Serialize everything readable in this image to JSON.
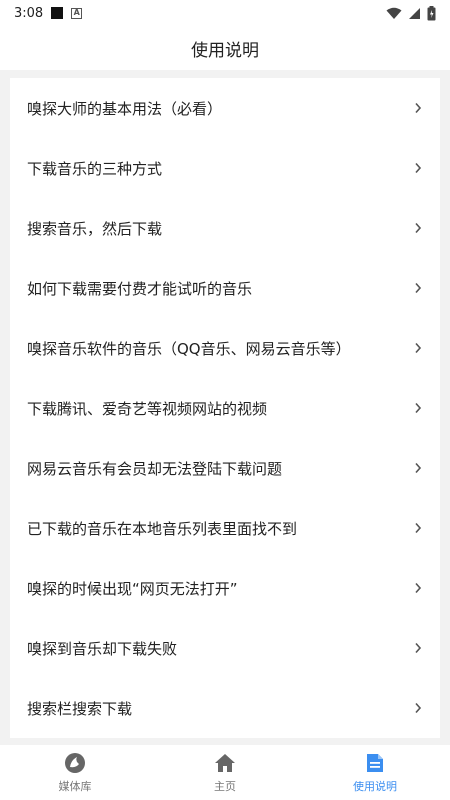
{
  "status_bar": {
    "time": "3:08"
  },
  "header": {
    "title": "使用说明"
  },
  "items": [
    {
      "label": "嗅探大师的基本用法（必看）"
    },
    {
      "label": "下载音乐的三种方式"
    },
    {
      "label": "搜索音乐，然后下载"
    },
    {
      "label": "如何下载需要付费才能试听的音乐"
    },
    {
      "label": "嗅探音乐软件的音乐（QQ音乐、网易云音乐等）"
    },
    {
      "label": "下载腾讯、爱奇艺等视频网站的视频"
    },
    {
      "label": "网易云音乐有会员却无法登陆下载问题"
    },
    {
      "label": "已下载的音乐在本地音乐列表里面找不到"
    },
    {
      "label": "嗅探的时候出现“网页无法打开”"
    },
    {
      "label": "嗅探到音乐却下载失败"
    },
    {
      "label": "搜索栏搜索下载"
    }
  ],
  "tabs": [
    {
      "label": "媒体库",
      "icon": "media-library-icon",
      "active": false
    },
    {
      "label": "主页",
      "icon": "home-icon",
      "active": false
    },
    {
      "label": "使用说明",
      "icon": "document-icon",
      "active": true
    }
  ],
  "colors": {
    "accent": "#3b8ef0",
    "inactive_icon": "#666666",
    "background": "#f2f2f2"
  }
}
